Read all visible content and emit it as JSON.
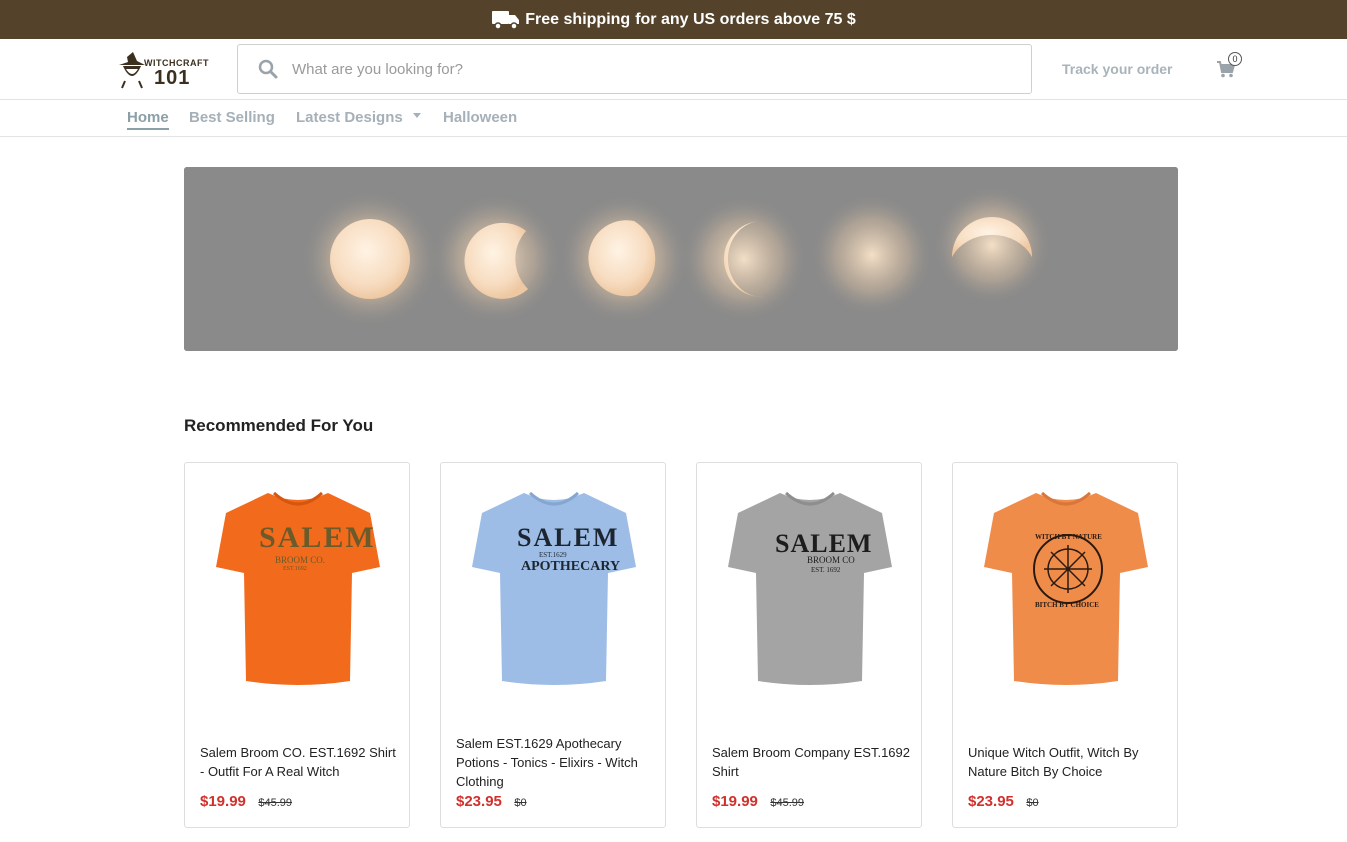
{
  "banner": {
    "icon": "truck-icon",
    "strong": "Free shipping",
    "rest": "for any US orders above 75 $"
  },
  "header": {
    "logo_line1": "WITCHCRAFT",
    "logo_line2": "101",
    "search_placeholder": "What are you looking for?",
    "search_value": "",
    "track_label": "Track your order",
    "cart_count": "0"
  },
  "nav": {
    "items": [
      {
        "label": "Home",
        "active": true
      },
      {
        "label": "Best Selling",
        "active": false
      },
      {
        "label": "Latest Designs",
        "active": false,
        "dropdown": true
      },
      {
        "label": "Halloween",
        "active": false
      }
    ]
  },
  "hero": {
    "description": "moon-phases-banner"
  },
  "recommended": {
    "title": "Recommended For You",
    "products": [
      {
        "name": "Salem Broom CO. EST.1692 Shirt - Outfit For A Real Witch",
        "price": "$19.99",
        "old_price": "$45.99",
        "shirt_color": "#f26a1b",
        "print_text_1": "SALEM",
        "print_text_2": "BROOM CO.",
        "print_text_3": "EST.1692"
      },
      {
        "name": "Salem EST.1629 Apothecary Potions - Tonics - Elixirs - Witch Clothing",
        "price": "$23.95",
        "old_price": "$0",
        "shirt_color": "#9dbde6",
        "print_text_1": "SALEM",
        "print_text_2": "APOTHECARY",
        "print_text_3": "EST.1629"
      },
      {
        "name": "Salem Broom Company EST.1692 Shirt",
        "price": "$19.99",
        "old_price": "$45.99",
        "shirt_color": "#a4a4a4",
        "print_text_1": "SALEM",
        "print_text_2": "BROOM CO",
        "print_text_3": "EST. 1692"
      },
      {
        "name": "Unique Witch Outfit, Witch By Nature Bitch By Choice",
        "price": "$23.95",
        "old_price": "$0",
        "shirt_color": "#f08c4a",
        "print_text_1": "WITCH BY NATURE",
        "print_text_2": "BITCH BY CHOICE",
        "print_text_3": ""
      }
    ]
  }
}
